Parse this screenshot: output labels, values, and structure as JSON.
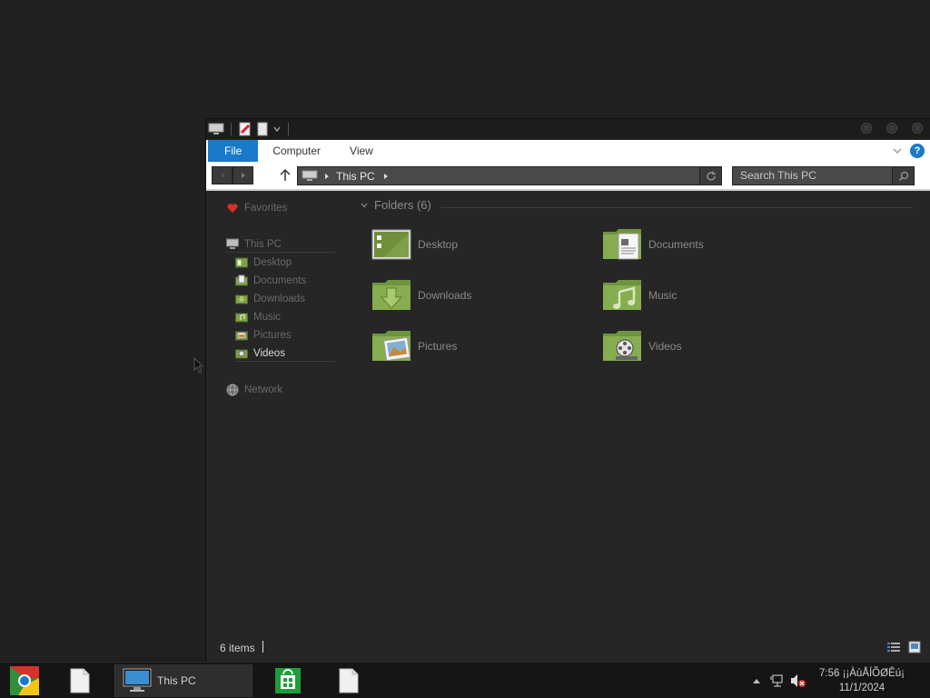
{
  "window": {
    "ribbon_tabs": [
      "File",
      "Computer",
      "View"
    ],
    "address": {
      "path": "This PC"
    },
    "search": {
      "placeholder": "Search This PC"
    }
  },
  "nav_pane": {
    "favorites": "Favorites",
    "this_pc": "This PC",
    "children": [
      "Desktop",
      "Documents",
      "Downloads",
      "Music",
      "Pictures",
      "Videos"
    ],
    "selected": "Videos",
    "network": "Network"
  },
  "content": {
    "group_header": "Folders (6)",
    "folders": [
      {
        "name": "Desktop",
        "icon": "desktop-folder-icon"
      },
      {
        "name": "Documents",
        "icon": "documents-folder-icon"
      },
      {
        "name": "Downloads",
        "icon": "downloads-folder-icon"
      },
      {
        "name": "Music",
        "icon": "music-folder-icon"
      },
      {
        "name": "Pictures",
        "icon": "pictures-folder-icon"
      },
      {
        "name": "Videos",
        "icon": "videos-folder-icon"
      }
    ]
  },
  "status": {
    "items": "6 items"
  },
  "taskbar": {
    "active_label": "This PC",
    "clock_time": "7:56 ¡¡ÀùÅÍÕØÊú¡",
    "clock_date": "11/1/2024"
  },
  "colors": {
    "accent": "#1979ca",
    "folder_green": "#7fa14a",
    "background": "#202020"
  }
}
